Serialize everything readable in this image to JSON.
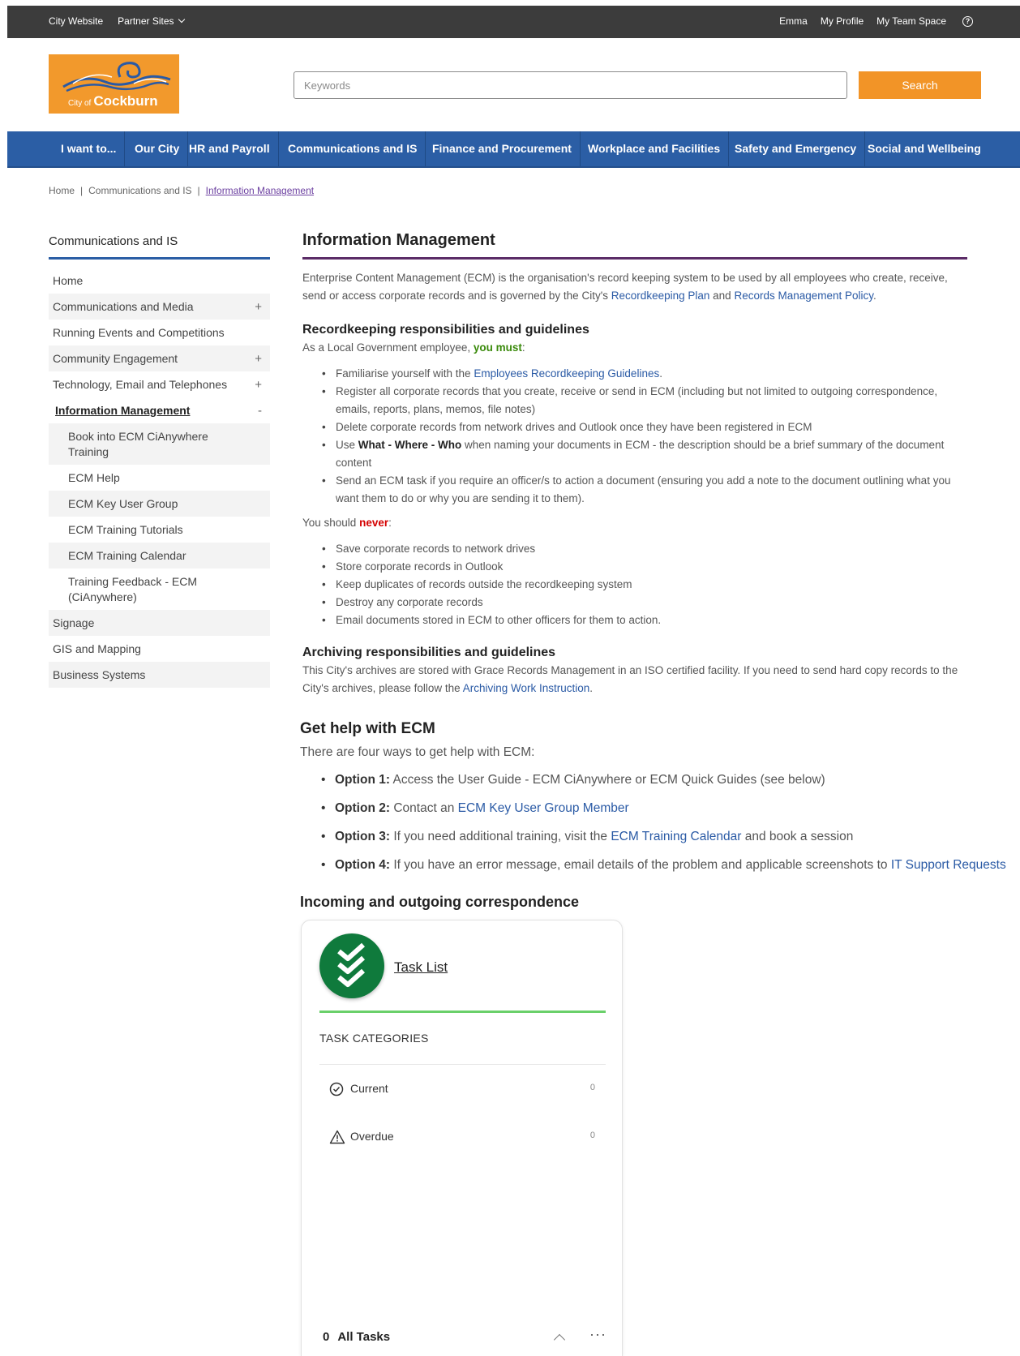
{
  "topbar": {
    "city_website": "City Website",
    "partner_sites": "Partner Sites",
    "user_name": "Emma",
    "my_profile": "My Profile",
    "my_team_space": "My Team Space"
  },
  "logo": {
    "prefix": "City of",
    "name": "Cockburn"
  },
  "search": {
    "placeholder": "Keywords",
    "button_label": "Search"
  },
  "nav": {
    "items": [
      "I want to...",
      "Our City",
      "HR and Payroll",
      "Communications and IS",
      "Finance and Procurement",
      "Workplace and Facilities",
      "Safety and Emergency",
      "Social and Wellbeing"
    ]
  },
  "breadcrumb": {
    "home": "Home",
    "section": "Communications and IS",
    "current": "Information Management"
  },
  "sidebar": {
    "title": "Communications and IS",
    "items": [
      {
        "label": "Home"
      },
      {
        "label": "Communications and Media",
        "toggle": "+"
      },
      {
        "label": "Running Events and Competitions"
      },
      {
        "label": "Community Engagement",
        "toggle": "+"
      },
      {
        "label": "Technology, Email and Telephones",
        "toggle": "+"
      },
      {
        "label": "Information Management",
        "toggle": "-"
      },
      {
        "label": "Book into ECM CiAnywhere Training"
      },
      {
        "label": "ECM Help"
      },
      {
        "label": "ECM Key User Group"
      },
      {
        "label": "ECM Training Tutorials"
      },
      {
        "label": "ECM Training Calendar"
      },
      {
        "label": "Training Feedback - ECM (CiAnywhere)"
      },
      {
        "label": "Signage"
      },
      {
        "label": "GIS and Mapping"
      },
      {
        "label": "Business Systems"
      }
    ]
  },
  "content": {
    "title": "Information Management",
    "intro": {
      "text": "Enterprise Content Management (ECM) is the organisation's record keeping system to be used by all employees who create, receive, send or access corporate records and is governed by the City's",
      "link1": "Recordkeeping Plan",
      "and": "and",
      "link2": "Records Management Policy",
      "end": "."
    },
    "recordkeeping": {
      "heading": "Recordkeeping responsibilities and guidelines",
      "must_lead": "As a Local Government employee,",
      "must_word": "you must",
      "colon": ":",
      "must_items": {
        "i0": {
          "pre": "Familiarise yourself with the",
          "link": "Employees Recordkeeping Guidelines",
          "post": "."
        },
        "i1": "Register all corporate records that you create, receive or send in ECM (including but not limited to outgoing correspondence, emails, reports, plans, memos, file notes)",
        "i2": "Delete corporate records from network drives and Outlook once they have been registered in ECM",
        "i3": {
          "pre": "Use",
          "bold": "What - Where - Who",
          "post": "when naming your documents in ECM - the description should be a brief summary of the document content"
        },
        "i4": "Send an ECM task if you require an officer/s to action a document (ensuring you add a note to the document outlining what you want them to do or why you are sending it to them)."
      },
      "never_lead": "You should",
      "never_word": "never",
      "never_items": [
        "Save corporate records to network drives",
        "Store corporate records in Outlook",
        "Keep duplicates of records outside the recordkeeping system",
        "Destroy any corporate records",
        "Email documents stored in ECM to other officers for them to action."
      ]
    },
    "archiving": {
      "heading": "Archiving responsibilities and guidelines",
      "text": "This City's archives are stored with Grace Records Management in an ISO certified facility. If you need to send hard copy records to the City's archives, please follow the",
      "link": "Archiving Work Instruction",
      "end": "."
    }
  },
  "help": {
    "heading": "Get help with ECM",
    "intro": "There are four ways to get help with ECM:",
    "o1": {
      "opt": "Option 1:",
      "text": "Access the User Guide - ECM CiAnywhere or ECM Quick Guides (see below)"
    },
    "o2": {
      "opt": "Option 2:",
      "text": "Contact an",
      "link": "ECM Key User Group Member"
    },
    "o3": {
      "opt": "Option 3:",
      "text": "If you need additional training, visit the",
      "link": "ECM Training Calendar",
      "post": "and book a session"
    },
    "o4": {
      "opt": "Option 4:",
      "text": "If you have an error message, email details of the problem and applicable screenshots to",
      "link": "IT Support Requests"
    }
  },
  "correspondence": {
    "heading": "Incoming and outgoing correspondence"
  },
  "task_card": {
    "title": "Task List",
    "categories_label": "TASK CATEGORIES",
    "current": {
      "label": "Current",
      "count": "0"
    },
    "overdue": {
      "label": "Overdue",
      "count": "0"
    },
    "footer_count": "0",
    "footer_label": "All Tasks",
    "more": "···",
    "badge_color": "#0f7a3c"
  },
  "colors": {
    "topbar": "#3c3c3c",
    "nav": "#2b5ea5",
    "accent_orange": "#f29427",
    "title_rule": "#5b2c67"
  }
}
